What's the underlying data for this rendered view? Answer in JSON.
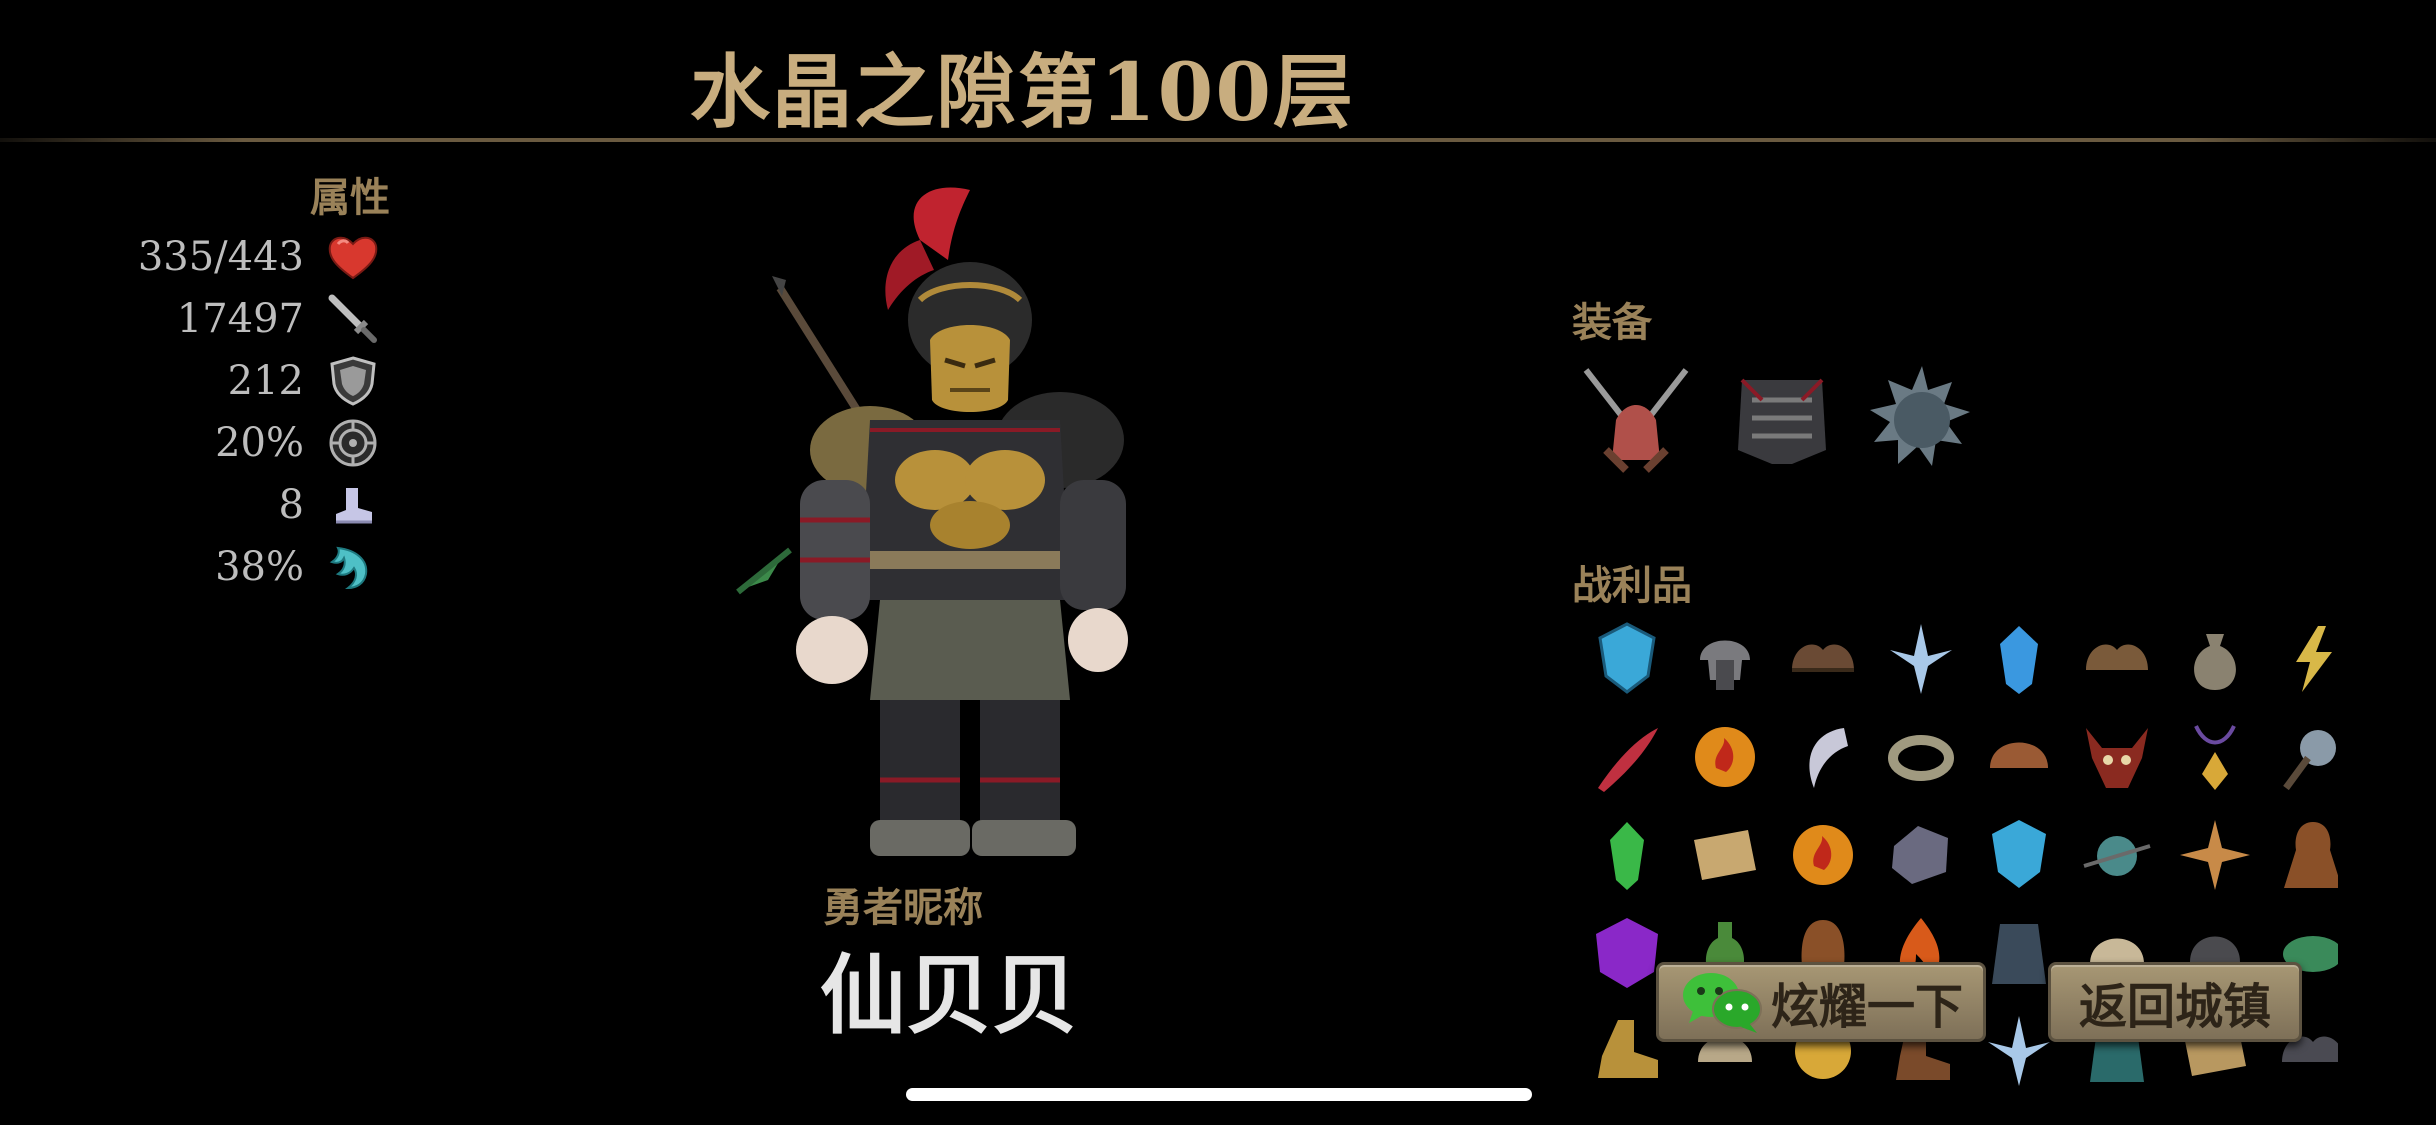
{
  "title": "水晶之隙第100层",
  "attributes": {
    "heading": "属性",
    "stats": [
      {
        "value": "335/443",
        "icon": "heart-icon",
        "color": "#d8382e"
      },
      {
        "value": "17497",
        "icon": "sword-icon",
        "color": "#9a9a9a"
      },
      {
        "value": "212",
        "icon": "shield-icon",
        "color": "#b0b0b0"
      },
      {
        "value": "20%",
        "icon": "critical-target-icon",
        "color": "#b0b0b0"
      },
      {
        "value": "8",
        "icon": "boot-icon",
        "color": "#c6c6e6"
      },
      {
        "value": "38%",
        "icon": "wind-claw-icon",
        "color": "#4ec0c6"
      }
    ]
  },
  "hero": {
    "nickname_label": "勇者昵称",
    "nickname": "仙贝贝"
  },
  "equipment": {
    "heading": "装备",
    "items": [
      "crossed-swords-icon",
      "dark-armor-icon",
      "spiked-helmet-icon"
    ]
  },
  "loot": {
    "heading": "战利品",
    "items": [
      "blue-crystal-shield-icon",
      "iron-helmet-icon",
      "leather-shoulder-icon",
      "ice-spike-icon",
      "blue-gem-icon",
      "leather-shoulder-icon",
      "pouch-icon",
      "lightning-rune-icon",
      "curved-dagger-icon",
      "fire-orb-icon",
      "moon-blade-icon",
      "ring-icon",
      "leather-cap-icon",
      "horned-mask-icon",
      "amulet-icon",
      "spiked-mace-icon",
      "green-gem-icon",
      "scroll-icon",
      "fire-orb-icon",
      "stone-icon",
      "blue-crystal-shield-icon",
      "spiked-ball-icon",
      "shuriken-icon",
      "brown-cloak-icon",
      "purple-rune-icon",
      "green-potion-icon",
      "brown-hood-icon",
      "flame-icon",
      "dark-robe-icon",
      "skull-cap-icon",
      "iron-helmet-icon",
      "green-shell-icon",
      "golden-boot-icon",
      "bone-helm-icon",
      "gold-coin-icon",
      "leather-boot-icon",
      "ice-spike-icon",
      "teal-robe-icon",
      "scroll-icon",
      "dark-shoulder-icon"
    ]
  },
  "buttons": {
    "share_label": "炫耀一下",
    "return_label": "返回城镇"
  }
}
